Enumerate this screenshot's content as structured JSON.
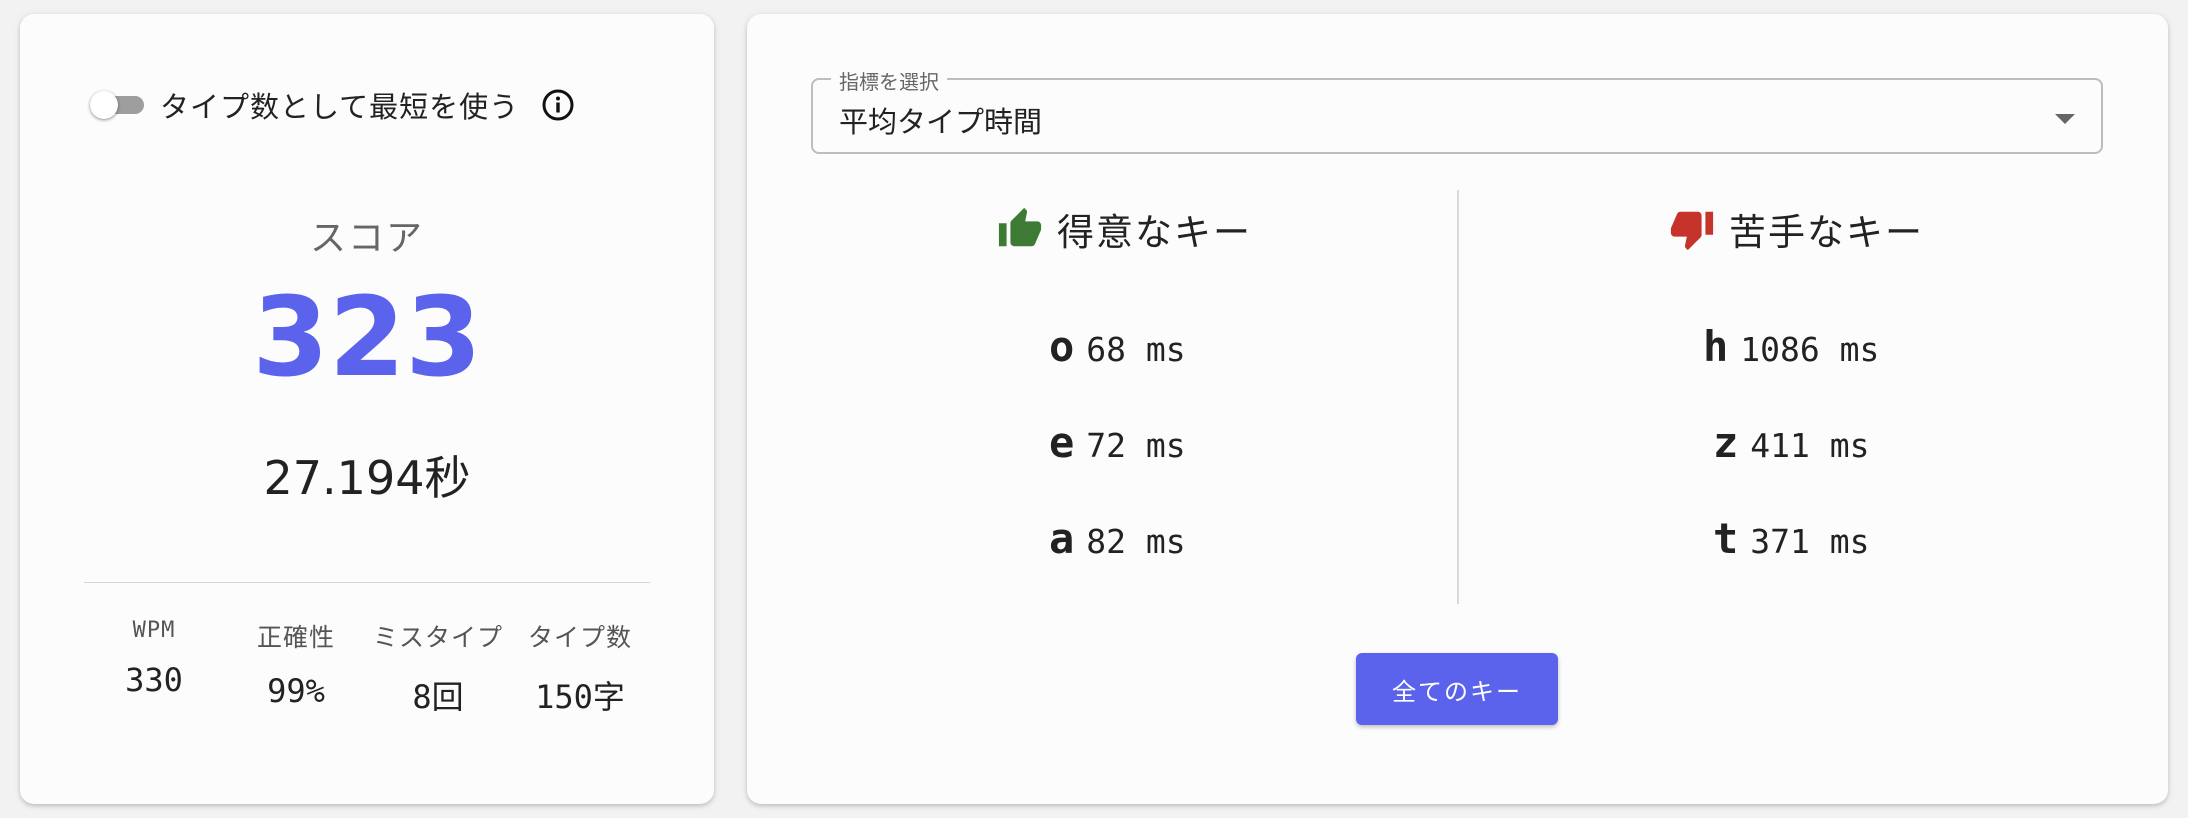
{
  "left": {
    "toggle_label": "タイプ数として最短を使う",
    "score_label": "スコア",
    "score": "323",
    "time": "27.194秒",
    "stats": [
      {
        "label": "WPM",
        "value": "330"
      },
      {
        "label": "正確性",
        "value": "99%"
      },
      {
        "label": "ミスタイプ",
        "value": "8回"
      },
      {
        "label": "タイプ数",
        "value": "150字"
      }
    ]
  },
  "right": {
    "select_legend": "指標を選択",
    "select_value": "平均タイプ時間",
    "good_heading": "得意なキー",
    "bad_heading": "苦手なキー",
    "good_keys": [
      {
        "key": "o",
        "value": "68 ms"
      },
      {
        "key": "e",
        "value": "72 ms"
      },
      {
        "key": "a",
        "value": "82 ms"
      }
    ],
    "bad_keys": [
      {
        "key": "h",
        "value": "1086 ms"
      },
      {
        "key": "z",
        "value": "411 ms"
      },
      {
        "key": "t",
        "value": "371 ms"
      }
    ],
    "all_keys_button": "全てのキー"
  },
  "colors": {
    "accent": "#5b63ec",
    "good": "#3d7b35",
    "bad": "#c6332b"
  },
  "icons": [
    "info-icon",
    "thumbs-up-icon",
    "thumbs-down-icon",
    "dropdown-arrow-icon"
  ]
}
